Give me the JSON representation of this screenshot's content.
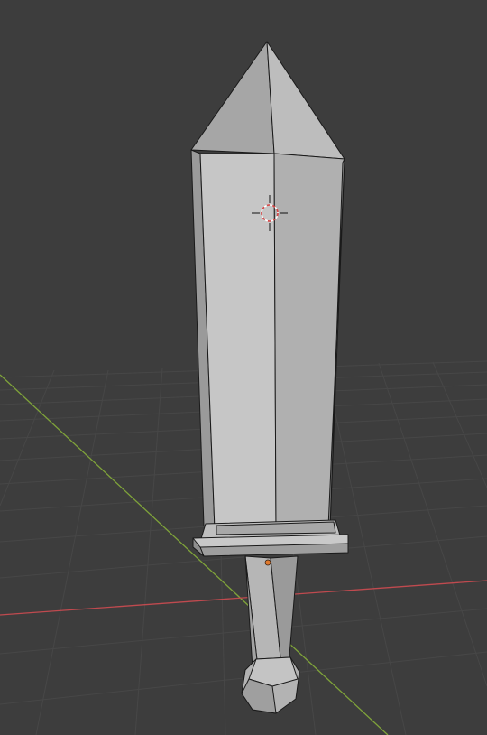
{
  "viewport": {
    "background_color": "#3d3d3d",
    "grid_color": "#4a4a4a",
    "x_axis_color": "#c04a4f",
    "y_axis_color": "#7fa33a",
    "selection_outline_color": "#111111"
  },
  "scene": {
    "objects": [
      {
        "name": "sword",
        "parts": [
          "blade-tip",
          "blade",
          "crossguard",
          "grip",
          "pommel"
        ]
      }
    ],
    "cursor_icon": "3d-cursor-icon",
    "origin_icon": "object-origin-icon",
    "material_color": "#b8b8b8"
  }
}
